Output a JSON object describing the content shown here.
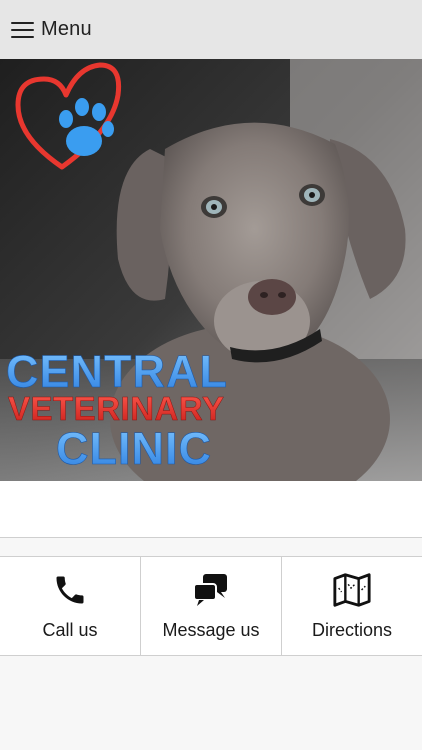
{
  "header": {
    "menu_label": "Menu"
  },
  "hero": {
    "logo": {
      "line1": "CENTRAL",
      "line2": "VETERINARY",
      "line3": "CLINIC"
    },
    "colors": {
      "blue": "#3a9df0",
      "red": "#e8372f"
    }
  },
  "actions": [
    {
      "label": "Call us",
      "icon": "phone-icon"
    },
    {
      "label": "Message us",
      "icon": "chat-icon"
    },
    {
      "label": "Directions",
      "icon": "map-icon"
    }
  ]
}
